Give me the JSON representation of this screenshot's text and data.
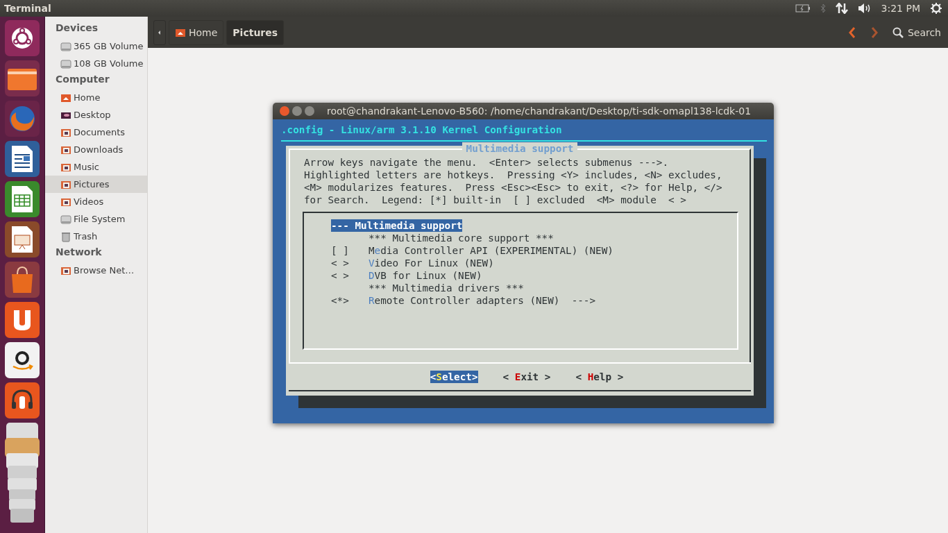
{
  "top_panel": {
    "app_title": "Terminal",
    "clock": "3:21 PM"
  },
  "sidebar": {
    "sections": [
      {
        "title": "Devices",
        "items": [
          {
            "label": "365 GB Volume",
            "kind": "drive",
            "selected": false
          },
          {
            "label": "108 GB Volume",
            "kind": "drive",
            "selected": false
          }
        ]
      },
      {
        "title": "Computer",
        "items": [
          {
            "label": "Home",
            "kind": "home",
            "selected": false
          },
          {
            "label": "Desktop",
            "kind": "desktop",
            "selected": false
          },
          {
            "label": "Documents",
            "kind": "folder",
            "selected": false
          },
          {
            "label": "Downloads",
            "kind": "folder",
            "selected": false
          },
          {
            "label": "Music",
            "kind": "folder",
            "selected": false
          },
          {
            "label": "Pictures",
            "kind": "folder",
            "selected": true
          },
          {
            "label": "Videos",
            "kind": "folder",
            "selected": false
          },
          {
            "label": "File System",
            "kind": "drive",
            "selected": false
          },
          {
            "label": "Trash",
            "kind": "trash",
            "selected": false
          }
        ]
      },
      {
        "title": "Network",
        "items": [
          {
            "label": "Browse Net…",
            "kind": "folder",
            "selected": false
          }
        ]
      }
    ]
  },
  "toolbar": {
    "breadcrumbs": [
      {
        "label": "Home",
        "selected": false
      },
      {
        "label": "Pictures",
        "selected": true
      }
    ],
    "search": "Search"
  },
  "terminal": {
    "title": "root@chandrakant-Lenovo-B560: /home/chandrakant/Desktop/ti-sdk-omapl138-lcdk-01",
    "header": ".config - Linux/arm 3.1.10 Kernel Configuration",
    "dialog": {
      "title": "Multimedia support",
      "help": "Arrow keys navigate the menu.  <Enter> selects submenus --->.\nHighlighted letters are hotkeys.  Pressing <Y> includes, <N> excludes,\n<M> modularizes features.  Press <Esc><Esc> to exit, <?> for Help, </>\nfor Search.  Legend: [*] built-in  [ ] excluded  <M> module  < >",
      "items": [
        {
          "kind": "menu",
          "lead": "--- Multimedia support",
          "selected": true
        },
        {
          "kind": "comment",
          "lead": "*** Multimedia core support ***",
          "selected": false
        },
        {
          "kind": "option",
          "prefix": "[ ]",
          "lead": "M",
          "hotkey": "e",
          "rest": "dia Controller API (EXPERIMENTAL) (NEW)",
          "selected": false
        },
        {
          "kind": "option",
          "prefix": "< >",
          "hotkey": "V",
          "rest": "ideo For Linux (NEW)",
          "selected": false
        },
        {
          "kind": "option",
          "prefix": "< >",
          "hotkey": "D",
          "rest": "VB for Linux (NEW)",
          "selected": false
        },
        {
          "kind": "comment",
          "lead": "*** Multimedia drivers ***",
          "selected": false
        },
        {
          "kind": "option",
          "prefix": "<*>",
          "hotkey": "R",
          "rest": "emote Controller adapters (NEW)  --->",
          "selected": false
        }
      ],
      "buttons": [
        {
          "lead": "<",
          "hotkey": "S",
          "rest": "elect>",
          "selected": true
        },
        {
          "lead": "< ",
          "hotkey": "E",
          "rest": "xit >",
          "selected": false
        },
        {
          "lead": "< ",
          "hotkey": "H",
          "rest": "elp >",
          "selected": false
        }
      ]
    }
  }
}
